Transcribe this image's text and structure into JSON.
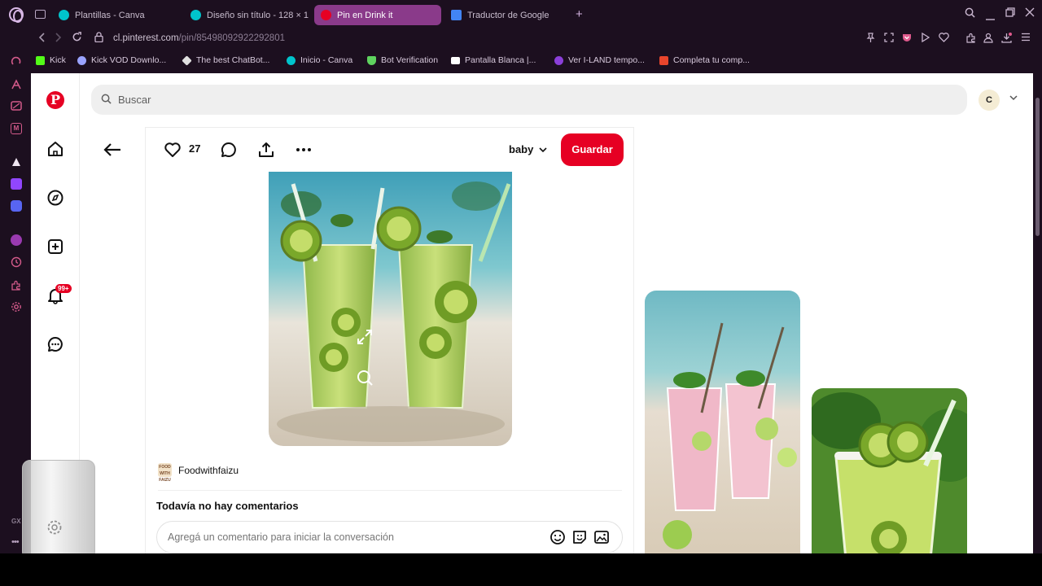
{
  "browser": {
    "tabs": [
      {
        "label": "Plantillas - Canva",
        "icon": "canva-icon",
        "color": "#00c4cc"
      },
      {
        "label": "Diseño sin título - 128 × 1",
        "icon": "canva-icon",
        "color": "#00c4cc"
      },
      {
        "label": "Pin en Drink it",
        "icon": "pinterest-icon",
        "color": "#e60023"
      },
      {
        "label": "Traductor de Google",
        "icon": "translate-icon",
        "color": "#4285f4"
      }
    ],
    "new_tab": "+",
    "url_host": "cl.pinterest.com",
    "url_path": "/pin/85498092922292801",
    "bookmarks": [
      {
        "label": "Kick",
        "color": "#53fc18"
      },
      {
        "label": "Kick VOD Downlo...",
        "color": "#9aa3ff"
      },
      {
        "label": "The best ChatBot...",
        "color": "#e0e0e0"
      },
      {
        "label": "Inicio - Canva",
        "color": "#00c4cc"
      },
      {
        "label": "Bot Verification",
        "color": "#5fd35f"
      },
      {
        "label": "Pantalla Blanca |...",
        "color": "#ffffff"
      },
      {
        "label": "Ver I-LAND tempo...",
        "color": "#8b3fd9"
      },
      {
        "label": "Completa tu comp...",
        "color": "#e8452c"
      }
    ],
    "sidebar_label": "GX"
  },
  "pinterest": {
    "brand_color": "#e60023",
    "logo": "P",
    "search_placeholder": "Buscar",
    "avatar_initial": "C",
    "notification_badge": "99+",
    "pin": {
      "likes": "27",
      "board": "baby",
      "save_label": "Guardar",
      "author": "Foodwithfaizu",
      "author_avatar_text": "FOOD WITH FAIZU",
      "no_comments": "Todavía no hay comentarios",
      "comment_placeholder": "Agregá un comentario para iniciar la conversación"
    }
  }
}
